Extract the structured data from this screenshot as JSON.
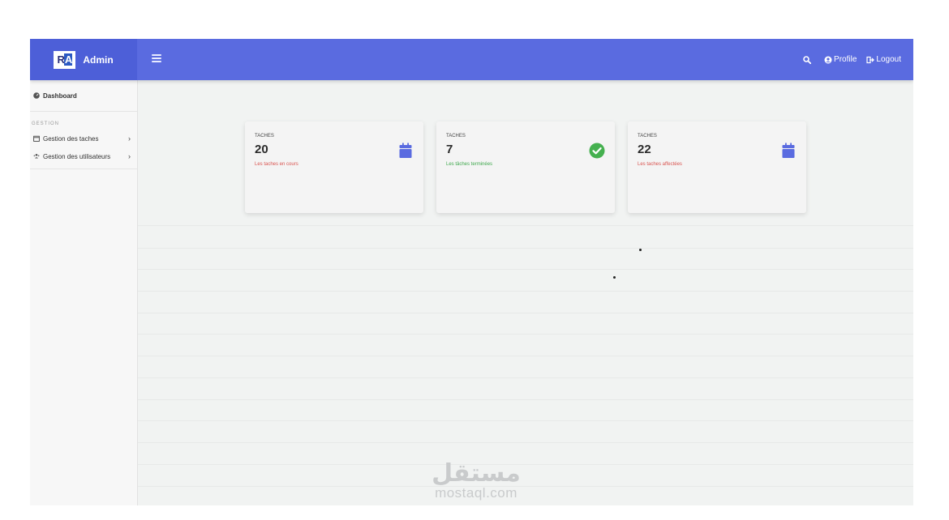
{
  "brand": {
    "logo": "RA",
    "name": "Admin"
  },
  "topnav": {
    "profile": "Profile",
    "logout": "Logout"
  },
  "sidebar": {
    "dashboard": "Dashboard",
    "section": "GESTION",
    "items": [
      {
        "label": "Gestion des taches",
        "icon": "calendar-icon"
      },
      {
        "label": "Gestion des utilisateurs",
        "icon": "users-icon"
      }
    ]
  },
  "cards": [
    {
      "label": "TACHES",
      "value": "20",
      "sub": "Les taches en cours",
      "sub_color": "#d9534f",
      "icon": "calendar-icon",
      "icon_color": "#5a6be0"
    },
    {
      "label": "TACHES",
      "value": "7",
      "sub": "Les tâches terminées",
      "sub_color": "#3fa84d",
      "icon": "check-circle-icon",
      "icon_color": "#45b04f"
    },
    {
      "label": "TACHES",
      "value": "22",
      "sub": "Les taches affectées",
      "sub_color": "#d9534f",
      "icon": "calendar-icon",
      "icon_color": "#5a6be0"
    }
  ],
  "watermark": {
    "arabic": "مستقل",
    "latin": "mostaql.com"
  },
  "colors": {
    "topbar": "#5a6be0",
    "brand": "#4d5fd8",
    "background": "#f1f3f2"
  }
}
